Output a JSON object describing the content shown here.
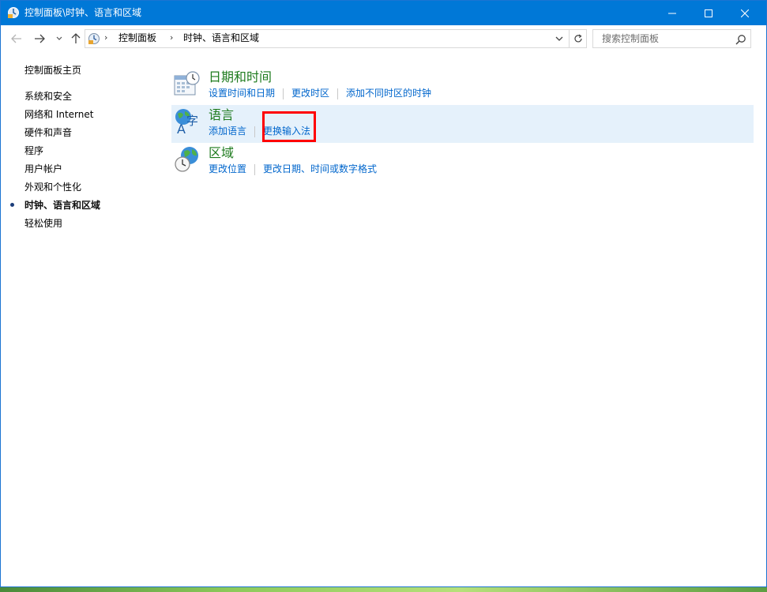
{
  "window": {
    "title": "控制面板\\时钟、语言和区域"
  },
  "navigation": {
    "breadcrumb": [
      "控制面板",
      "时钟、语言和区域"
    ],
    "search_placeholder": "搜索控制面板"
  },
  "sidebar": {
    "home": "控制面板主页",
    "items": [
      {
        "label": "系统和安全",
        "current": false
      },
      {
        "label": "网络和 Internet",
        "current": false
      },
      {
        "label": "硬件和声音",
        "current": false
      },
      {
        "label": "程序",
        "current": false
      },
      {
        "label": "用户帐户",
        "current": false
      },
      {
        "label": "外观和个性化",
        "current": false
      },
      {
        "label": "时钟、语言和区域",
        "current": true
      },
      {
        "label": "轻松使用",
        "current": false
      }
    ]
  },
  "categories": [
    {
      "title": "日期和时间",
      "icon": "calendar-clock-icon",
      "links": [
        "设置时间和日期",
        "更改时区",
        "添加不同时区的时钟"
      ]
    },
    {
      "title": "语言",
      "icon": "language-globe-icon",
      "links": [
        "添加语言",
        "更换输入法"
      ]
    },
    {
      "title": "区域",
      "icon": "region-globe-clock-icon",
      "links": [
        "更改位置",
        "更改日期、时间或数字格式"
      ]
    }
  ],
  "colors": {
    "titlebar": "#0078d7",
    "category_title": "#1e7b1e",
    "link": "#0066cc",
    "hover_row": "#e5f1fb",
    "annotation": "#ff0000"
  }
}
